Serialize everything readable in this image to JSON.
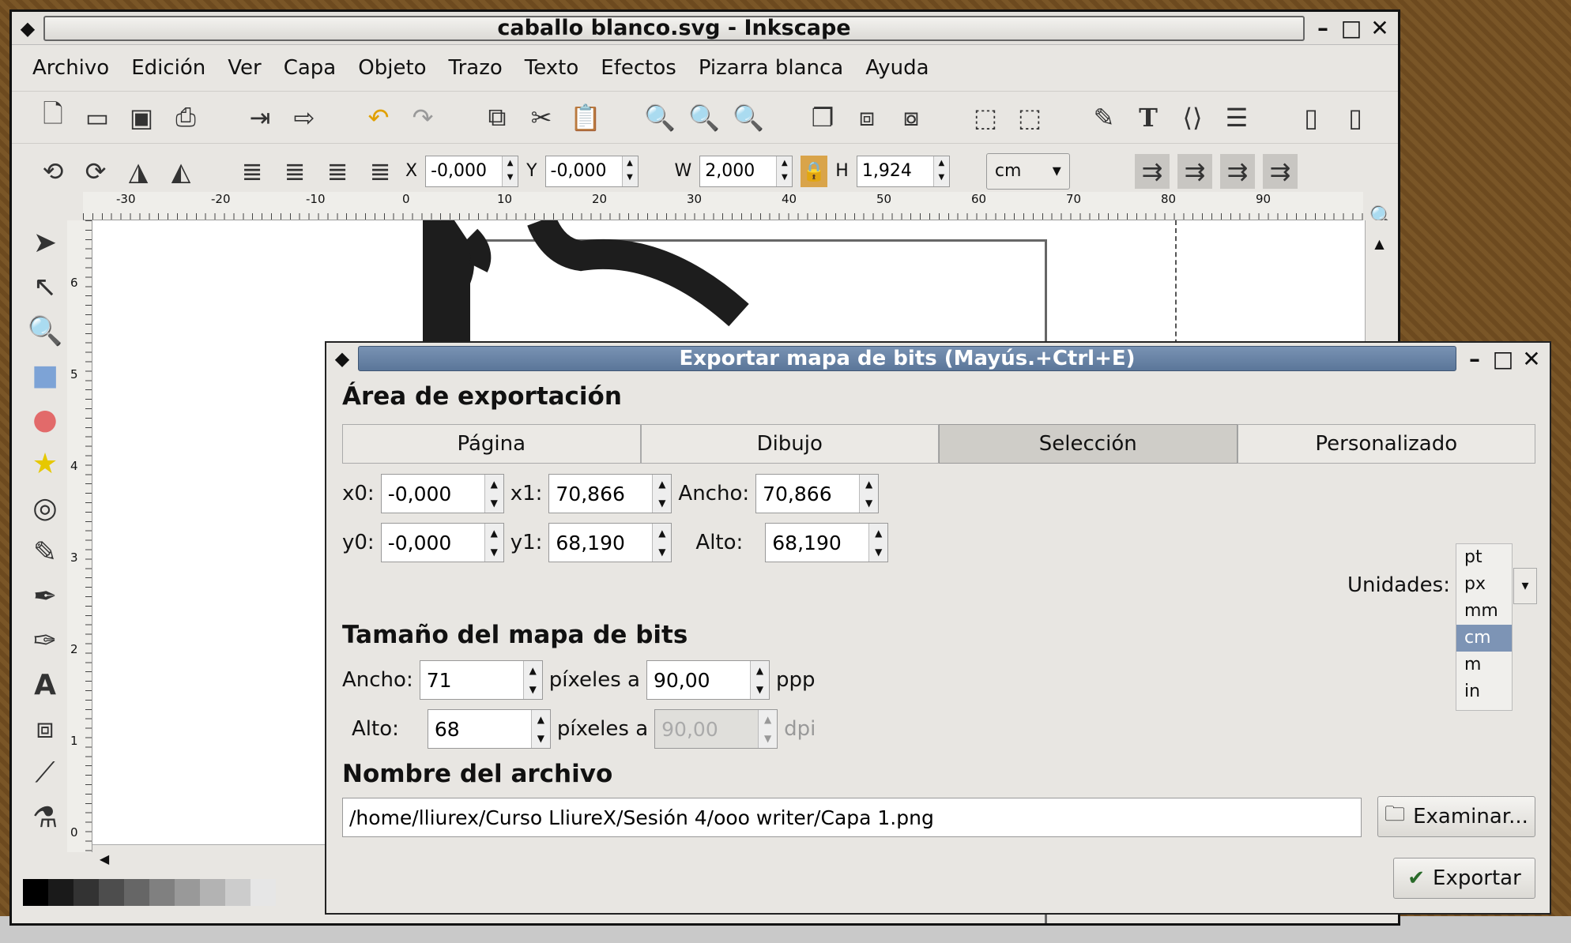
{
  "window": {
    "title": "caballo blanco.svg - Inkscape",
    "controls": [
      "–",
      "□",
      "✕"
    ]
  },
  "menu": [
    "Archivo",
    "Edición",
    "Ver",
    "Capa",
    "Objeto",
    "Trazo",
    "Texto",
    "Efectos",
    "Pizarra blanca",
    "Ayuda"
  ],
  "toolbar2": {
    "x_label": "X",
    "x_value": "-0,000",
    "y_label": "Y",
    "y_value": "-0,000",
    "w_label": "W",
    "w_value": "2,000",
    "h_label": "H",
    "h_value": "1,924",
    "unit": "cm"
  },
  "ruler_top": [
    "-30",
    "-20",
    "-10",
    "0",
    "10",
    "20",
    "30",
    "40",
    "50",
    "60",
    "70",
    "80",
    "90"
  ],
  "ruler_left": [
    "6",
    "5",
    "4",
    "3",
    "2",
    "1",
    "0"
  ],
  "dialog": {
    "title": "Exportar mapa de bits (Mayús.+Ctrl+E)",
    "area_heading": "Área de exportación",
    "tabs": [
      "Página",
      "Dibujo",
      "Selección",
      "Personalizado"
    ],
    "active_tab": "Selección",
    "x0_label": "x0:",
    "x0": "-0,000",
    "x1_label": "x1:",
    "x1": "70,866",
    "width_label": "Ancho:",
    "width": "70,866",
    "y0_label": "y0:",
    "y0": "-0,000",
    "y1_label": "y1:",
    "y1": "68,190",
    "height_label": "Alto:",
    "height": "68,190",
    "units_label": "Unidades:",
    "units_options": [
      "pt",
      "px",
      "mm",
      "cm",
      "m",
      "in"
    ],
    "units_selected": "cm",
    "bitmap_heading": "Tamaño del mapa de bits",
    "bm_width_label": "Ancho:",
    "bm_width": "71",
    "bm_height_label": "Alto:",
    "bm_height": "68",
    "pixels_at": "píxeles a",
    "dpi_x": "90,00",
    "dpi_x_unit": "ppp",
    "dpi_y": "90,00",
    "dpi_y_unit": "dpi",
    "filename_heading": "Nombre del archivo",
    "filename": "/home/lliurex/Curso LliureX/Sesión 4/ooo writer/Capa 1.png",
    "browse_label": "Examinar...",
    "export_label": "Exportar"
  }
}
